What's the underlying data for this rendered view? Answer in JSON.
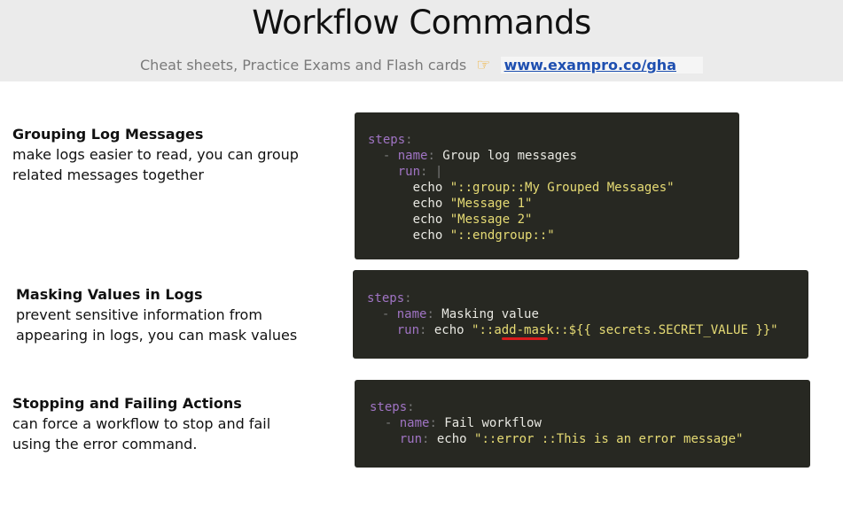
{
  "header": {
    "title": "Workflow Commands",
    "subtitle": "Cheat sheets, Practice Exams and Flash cards",
    "pointer_icon": "pointing-hand-emoji",
    "link_text": "www.exampro.co/gha",
    "link_color": "#1e4fb0"
  },
  "sections": [
    {
      "heading": "Grouping Log Messages",
      "line1": "make logs easier to read, you can group",
      "line2": "related messages together",
      "code": {
        "steps": "steps",
        "name_key": "name",
        "name_val": "Group log messages",
        "run_key": "run",
        "run_pipe": "|",
        "l1_cmd": "echo",
        "l1_str": "\"::group::My Grouped Messages\"",
        "l2_cmd": "echo",
        "l2_str": "\"Message 1\"",
        "l3_cmd": "echo",
        "l3_str": "\"Message 2\"",
        "l4_cmd": "echo",
        "l4_str": "\"::endgroup::\""
      }
    },
    {
      "heading": "Masking Values in Logs",
      "line1": "prevent sensitive information from",
      "line2": "appearing in logs, you can mask values",
      "code": {
        "steps": "steps",
        "name_key": "name",
        "name_val": "Masking value",
        "run_key": "run",
        "run_cmd": "echo",
        "run_str": "\"::add-mask::${{ secrets.SECRET_VALUE }}\""
      }
    },
    {
      "heading": "Stopping and Failing Actions",
      "line1": "can force a workflow to stop and fail",
      "line2": "using the error command.",
      "code": {
        "steps": "steps",
        "name_key": "name",
        "name_val": "Fail workflow",
        "run_key": "run",
        "run_cmd": "echo",
        "run_str": "\"::error ::This is an error message\""
      }
    }
  ],
  "colors": {
    "code_bg": "#272822",
    "keyword": "#a074c4",
    "string": "#e6db74",
    "annotation_underline": "#d91c1c"
  }
}
